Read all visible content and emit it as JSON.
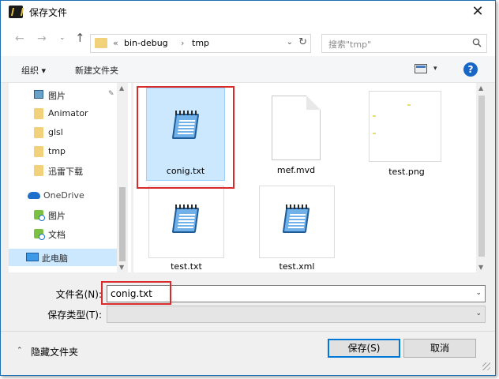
{
  "window": {
    "title": "保存文件",
    "close_glyph": "✕"
  },
  "nav": {
    "back_glyph": "←",
    "forward_glyph": "→",
    "recent_glyph": "⌄",
    "up_glyph": "↑",
    "breadcrumb": [
      {
        "label": "«"
      },
      {
        "label": "bin-debug"
      },
      {
        "label": "›"
      },
      {
        "label": "tmp"
      }
    ],
    "refresh_glyph": "↻",
    "search_placeholder": "搜索\"tmp\""
  },
  "toolbar": {
    "organize_label": "组织 ▾",
    "new_folder_label": "新建文件夹",
    "view_dropdown_glyph": "▾",
    "help_label": "?"
  },
  "sidebar": {
    "items": [
      {
        "label": "图片",
        "icon": "pictures-icon",
        "type": "quick"
      },
      {
        "label": "Animator",
        "icon": "folder-icon",
        "type": "quick"
      },
      {
        "label": "glsl",
        "icon": "folder-icon",
        "type": "quick"
      },
      {
        "label": "tmp",
        "icon": "folder-icon",
        "type": "quick"
      },
      {
        "label": "迅雷下载",
        "icon": "folder-icon",
        "type": "quick"
      },
      {
        "label": "OneDrive",
        "icon": "onedrive-icon",
        "type": "root"
      },
      {
        "label": "图片",
        "icon": "onedrive-pictures-icon",
        "type": "sub"
      },
      {
        "label": "文档",
        "icon": "onedrive-documents-icon",
        "type": "sub"
      },
      {
        "label": "此电脑",
        "icon": "this-pc-icon",
        "type": "root"
      }
    ],
    "pin_glyph": "✎"
  },
  "files": [
    {
      "name": "conig.txt",
      "icon": "notepad-file-icon",
      "selected": true
    },
    {
      "name": "mef.mvd",
      "icon": "blank-file-icon",
      "selected": false
    },
    {
      "name": "test.png",
      "icon": "image-thumbnail-icon",
      "selected": false
    },
    {
      "name": "test.txt",
      "icon": "notepad-file-icon",
      "selected": false
    },
    {
      "name": "test.xml",
      "icon": "notepad-file-icon",
      "selected": false
    }
  ],
  "form": {
    "filename_label": "文件名(N):",
    "filename_value": "conig.txt",
    "filetype_label": "保存类型(T):",
    "filetype_value": "",
    "dropdown_glyph": "⌄"
  },
  "footer": {
    "hide_folders_label": "隐藏文件夹",
    "hide_folders_glyph": "⌃",
    "save_label": "保存(S)",
    "cancel_label": "取消"
  },
  "scroll_glyphs": {
    "up": "▲",
    "down": "▼"
  },
  "colors": {
    "accent": "#0078d7",
    "selection": "#cce8ff",
    "highlight_annotation": "#d92b2b",
    "help_icon": "#1866c6"
  }
}
